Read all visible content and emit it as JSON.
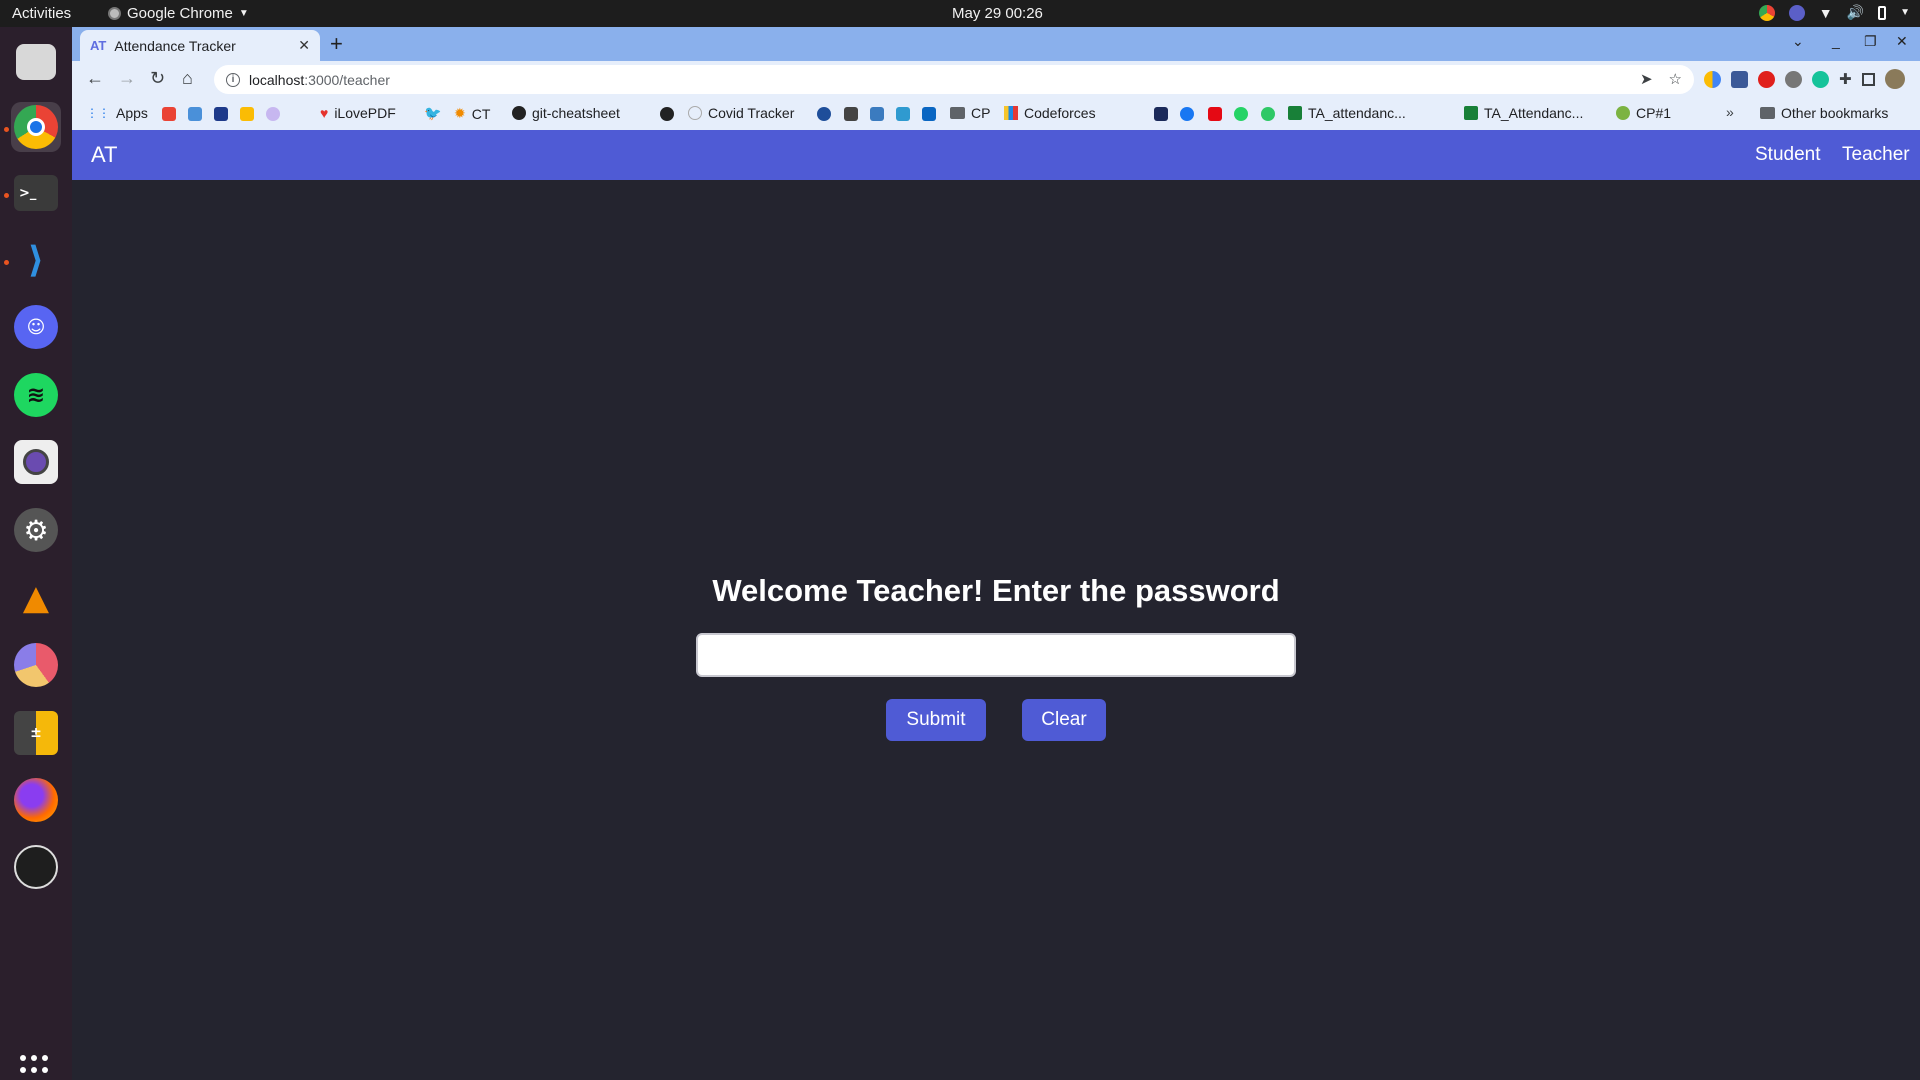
{
  "topbar": {
    "activities": "Activities",
    "app_menu": "Google Chrome",
    "clock": "May 29  00:26"
  },
  "dock": {
    "items": [
      "files-icon",
      "chrome-icon",
      "terminal-icon",
      "vscode-icon",
      "discord-icon",
      "spotify-icon",
      "camera-icon",
      "settings-icon",
      "vlc-icon",
      "pie-chart-icon",
      "calculator-icon",
      "firefox-icon",
      "obs-icon"
    ]
  },
  "browser": {
    "tab_title": "Attendance Tracker",
    "tab_favicon": "AT",
    "url_host": "localhost",
    "url_path": ":3000/teacher",
    "bookmarks": [
      "Apps",
      "iLovePDF",
      "CT",
      "git-cheatsheet",
      "Covid Tracker",
      "CP",
      "Codeforces",
      "TA_attendanc...",
      "TA_Attendanc...",
      "CP#1"
    ],
    "other_bookmarks": "Other bookmarks"
  },
  "app": {
    "brand": "AT",
    "nav": {
      "student": "Student",
      "teacher": "Teacher"
    },
    "heading": "Welcome Teacher! Enter the password",
    "password_value": "",
    "submit_label": "Submit",
    "clear_label": "Clear",
    "colors": {
      "accent": "#4f5bd5",
      "background": "#24242f"
    }
  }
}
